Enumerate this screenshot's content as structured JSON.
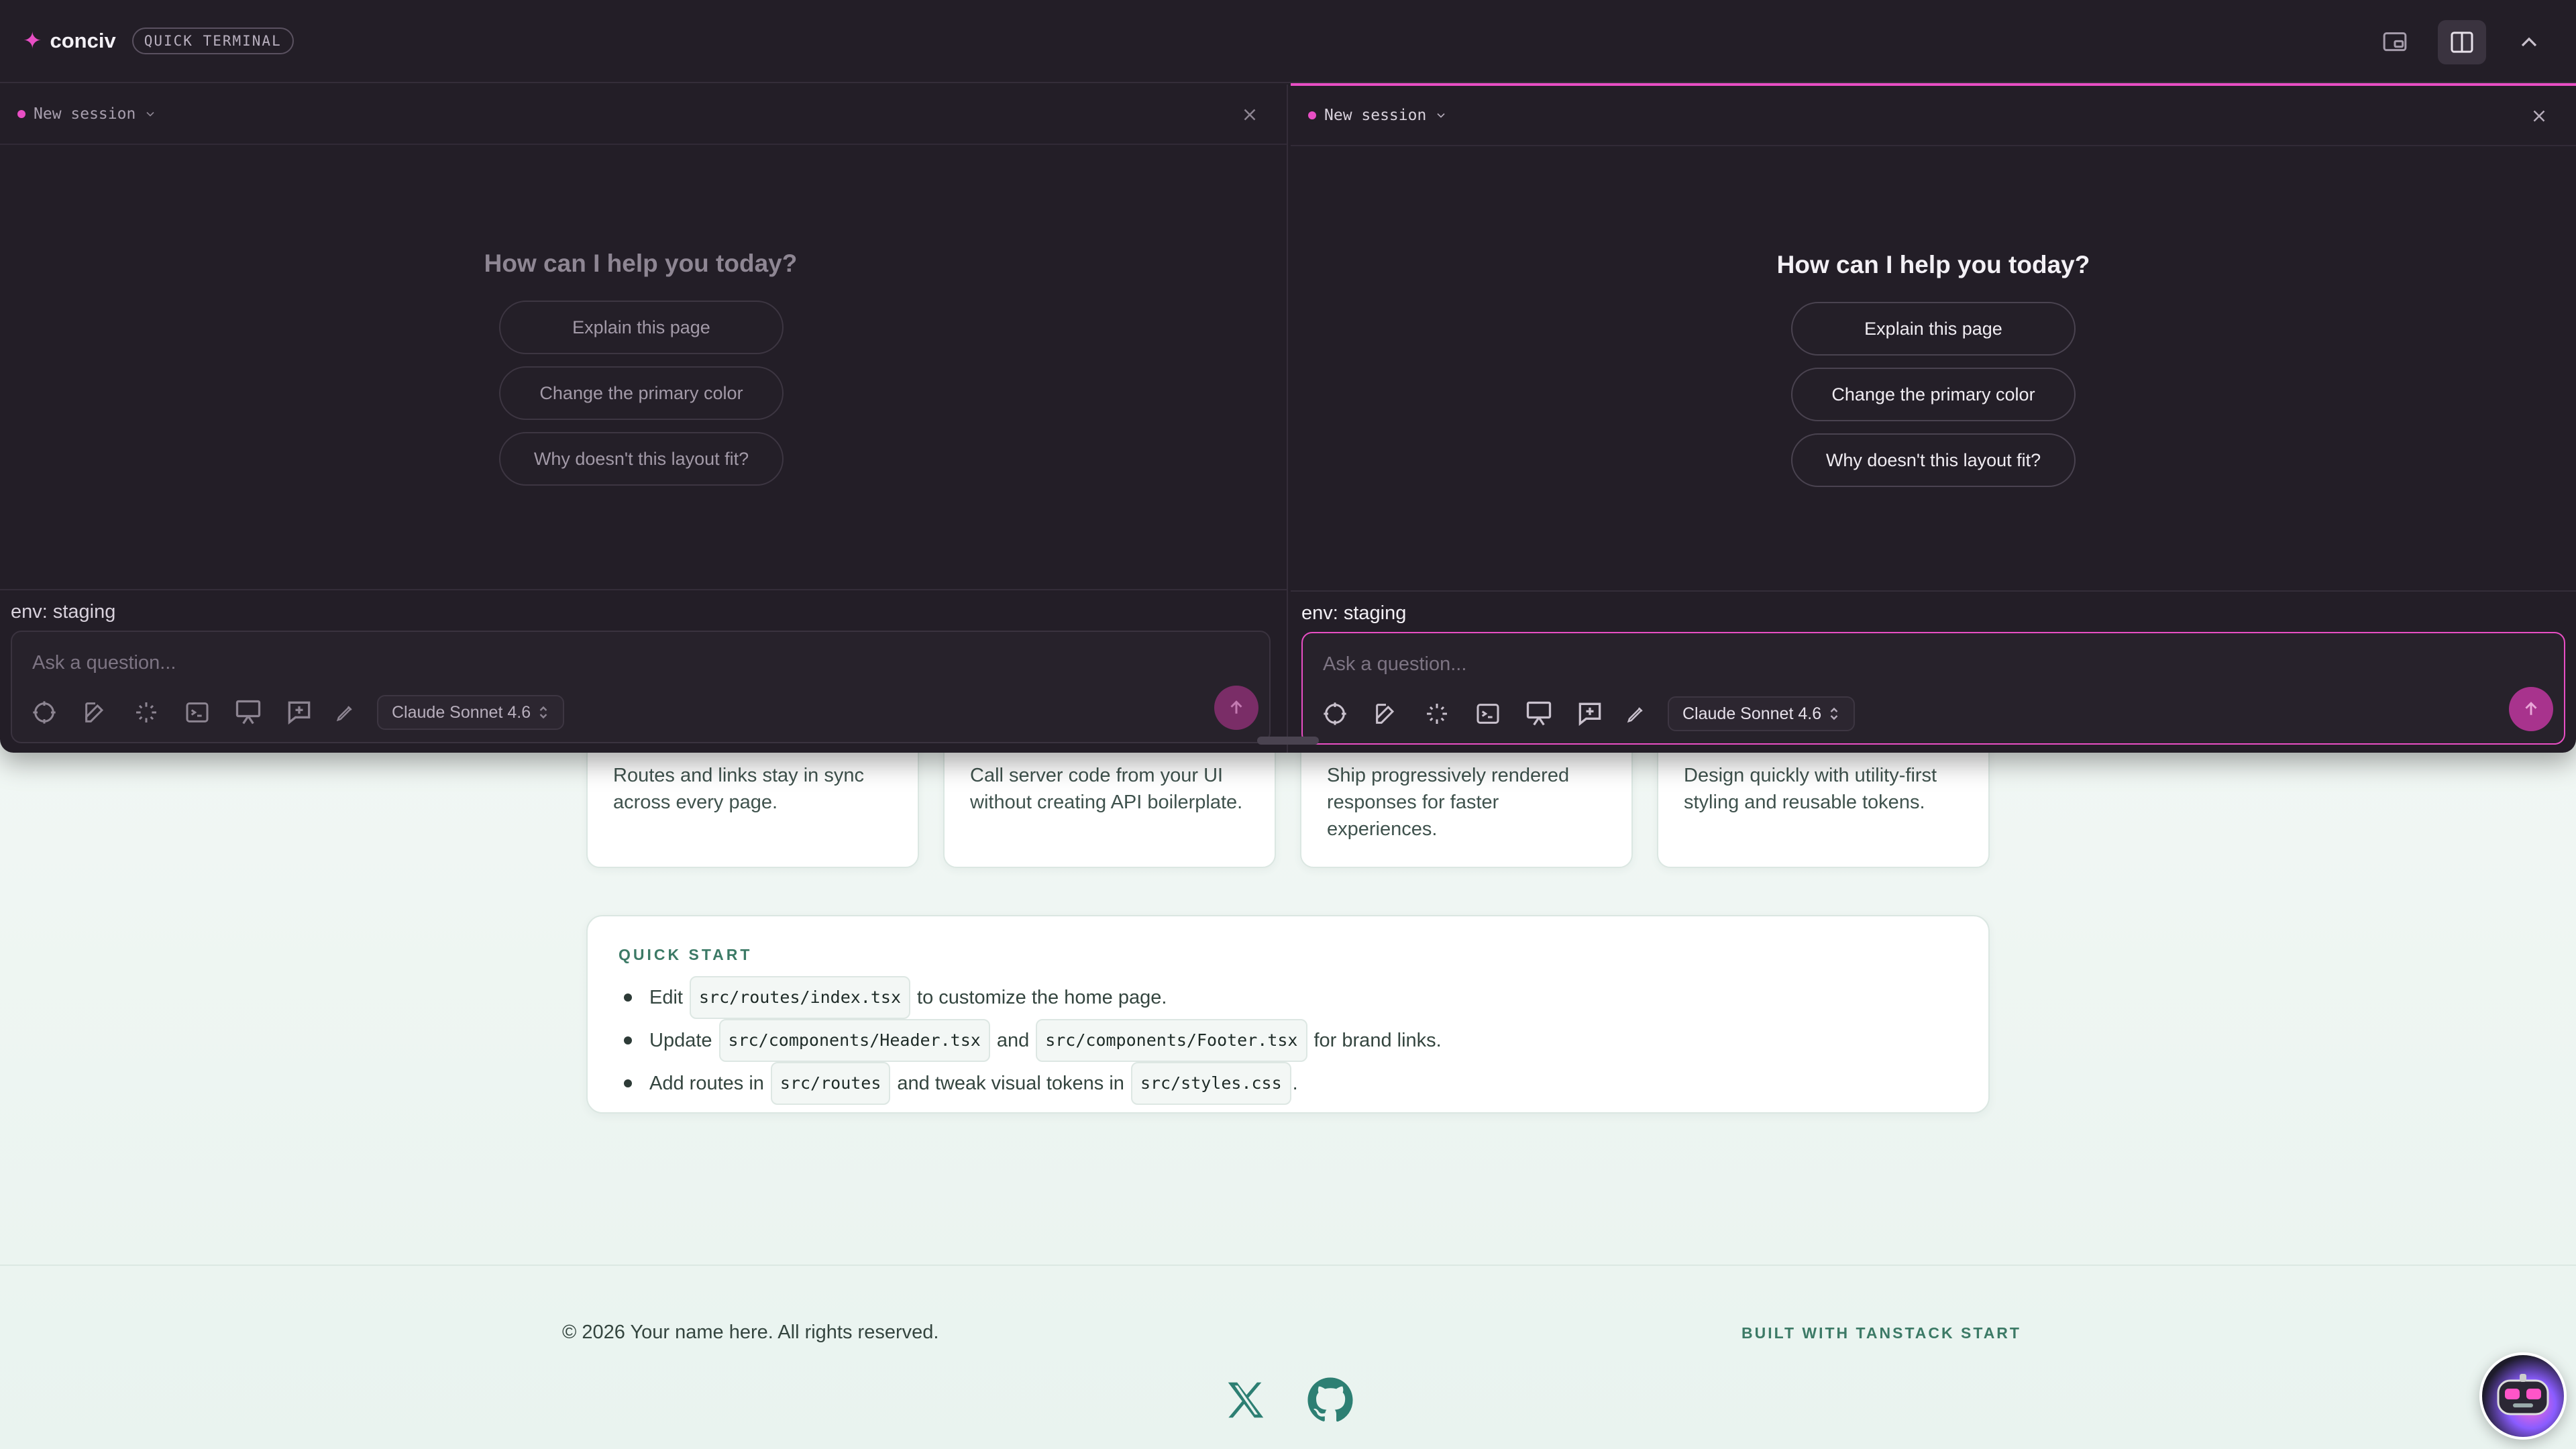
{
  "app": {
    "brand": "conciv",
    "badge": "QUICK TERMINAL"
  },
  "panes": [
    {
      "session_label": "New session",
      "greeting": "How can I help you today?",
      "suggestions": [
        "Explain this page",
        "Change the primary color",
        "Why doesn't this layout fit?"
      ],
      "env": "env: staging",
      "input_placeholder": "Ask a question...",
      "model": "Claude Sonnet 4.6"
    },
    {
      "session_label": "New session",
      "greeting": "How can I help you today?",
      "suggestions": [
        "Explain this page",
        "Change the primary color",
        "Why doesn't this layout fit?"
      ],
      "env": "env: staging",
      "input_placeholder": "Ask a question...",
      "model": "Claude Sonnet 4.6"
    }
  ],
  "features": [
    {
      "text": "Routes and links stay in sync across every page."
    },
    {
      "text": "Call server code from your UI without creating API boilerplate."
    },
    {
      "text": "Ship progressively rendered responses for faster experiences."
    },
    {
      "text": "Design quickly with utility-first styling and reusable tokens."
    }
  ],
  "quick_start": {
    "title": "QUICK START",
    "line1": {
      "a": "Edit",
      "code1": "src/routes/index.tsx",
      "b": "to customize the home page."
    },
    "line2": {
      "a": "Update",
      "code1": "src/components/Header.tsx",
      "b": "and",
      "code2": "src/components/Footer.tsx",
      "c": "for brand links."
    },
    "line3": {
      "a": "Add routes in",
      "code1": "src/routes",
      "b": "and tweak visual tokens in",
      "code2": "src/styles.css",
      "c": "."
    }
  },
  "footer": {
    "copyright": "© 2026 Your name here. All rights reserved.",
    "built_with": "BUILT WITH TANSTACK START"
  },
  "colors": {
    "accent": "#e84ec4",
    "terminal_bg": "#231e27",
    "page_bg": "#eef6f3",
    "quick_start_heading": "#3c7a66"
  },
  "icons": [
    "sparkle-icon",
    "picture-in-picture-icon",
    "split-view-icon",
    "chevron-up-icon",
    "chevron-down-icon",
    "close-icon",
    "crosshair-icon",
    "edit-icon",
    "sparkles-icon",
    "terminal-icon",
    "presentation-icon",
    "message-plus-icon",
    "pen-icon",
    "arrow-up-icon",
    "x-logo-icon",
    "github-icon",
    "mascot-robot-icon"
  ]
}
